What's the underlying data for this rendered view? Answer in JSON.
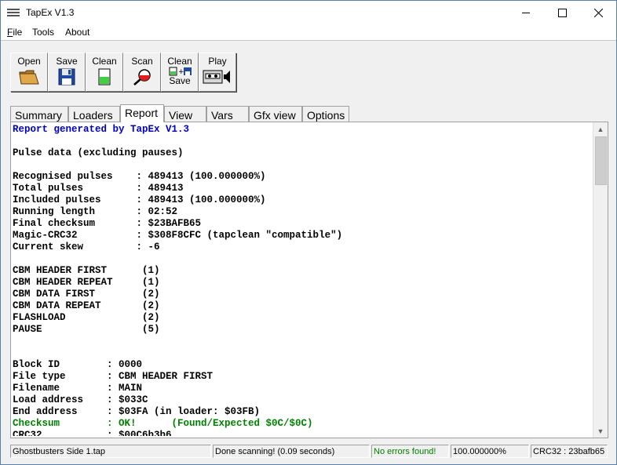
{
  "window": {
    "title": "TapEx V1.3"
  },
  "menu": [
    {
      "label": "File",
      "underline": "F"
    },
    {
      "label": "Tools"
    },
    {
      "label": "About"
    }
  ],
  "toolbar": {
    "open": "Open",
    "save": "Save",
    "clean": "Clean",
    "scan": "Scan",
    "clean_save_1": "Clean",
    "clean_save_2": "Save",
    "play": "Play"
  },
  "tabs": [
    "Summary",
    "Loaders",
    "Report",
    "View",
    "Vars",
    "Gfx view",
    "Options"
  ],
  "active_tab": "Report",
  "report": {
    "lines": [
      {
        "text": "Report generated by TapEx V1.3",
        "style": "blue"
      },
      {
        "text": ""
      },
      {
        "text": "Pulse data (excluding pauses)"
      },
      {
        "text": ""
      },
      {
        "text": "Recognised pulses    : 489413 (100.000000%)"
      },
      {
        "text": "Total pulses         : 489413"
      },
      {
        "text": "Included pulses      : 489413 (100.000000%)"
      },
      {
        "text": "Running length       : 02:52"
      },
      {
        "text": "Final checksum       : $23BAFB65"
      },
      {
        "text": "Magic-CRC32          : $308F8CFC (tapclean \"compatible\")"
      },
      {
        "text": "Current skew         : -6"
      },
      {
        "text": ""
      },
      {
        "text": "CBM HEADER FIRST      (1)"
      },
      {
        "text": "CBM HEADER REPEAT     (1)"
      },
      {
        "text": "CBM DATA FIRST        (2)"
      },
      {
        "text": "CBM DATA REPEAT       (2)"
      },
      {
        "text": "FLASHLOAD             (2)"
      },
      {
        "text": "PAUSE                 (5)"
      },
      {
        "text": ""
      },
      {
        "text": ""
      },
      {
        "text": "Block ID        : 0000"
      },
      {
        "text": "File type       : CBM HEADER FIRST"
      },
      {
        "text": "Filename        : MAIN"
      },
      {
        "text": "Load address    : $033C"
      },
      {
        "text": "End address     : $03FA (in loader: $03FB)"
      },
      {
        "text": "Checksum        : OK!      (Found/Expected $0C/$0C)",
        "style": "green"
      },
      {
        "text": "CRC32           : $00C6b3b6"
      }
    ]
  },
  "statusbar": {
    "file": "Ghostbusters Side 1.tap",
    "message": "Done scanning! (0.09 seconds)",
    "errors": "No errors found!",
    "percent": "100.000000%",
    "crc": "CRC32 : 23bafb65"
  },
  "colors": {
    "report_blue": "#0000c0",
    "ok_green": "#008000"
  }
}
